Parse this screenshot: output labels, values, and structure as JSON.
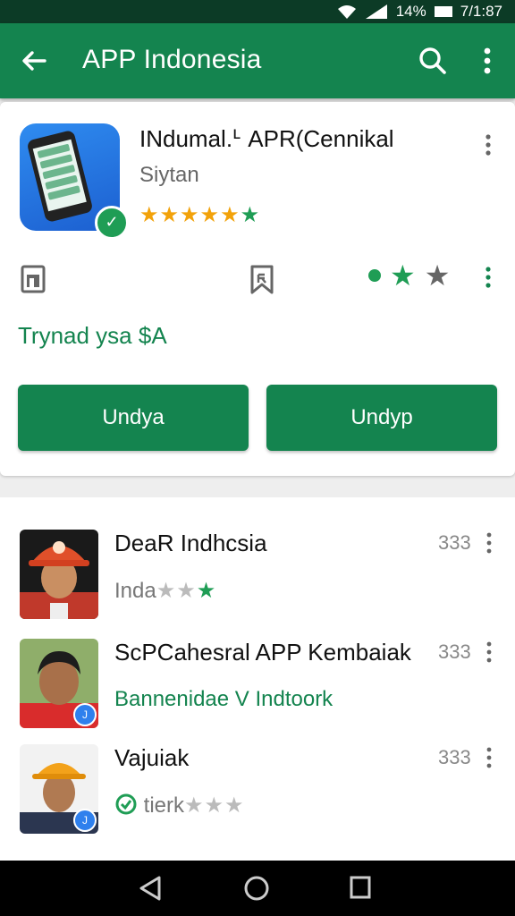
{
  "status_bar": {
    "battery": "14%",
    "time": "7/1:87"
  },
  "app_bar": {
    "title": "APP Indonesia",
    "icons": [
      "back-arrow-icon",
      "search-icon",
      "more-vert-icon"
    ]
  },
  "app": {
    "name": "INdumal.ᒻ APR(Cennikal",
    "developer": "Siytan",
    "rating_text": "★★★★★",
    "rating_last": "★",
    "price": "Trynad ysa $A",
    "button_left": "Undya",
    "button_right": "Undyp"
  },
  "list": [
    {
      "title": "DeaR Indhcsia",
      "sub": "Inda",
      "stars_grey": "★★",
      "stars_green": "★",
      "price": "333"
    },
    {
      "title": "ScPCahesral APP Kembaiak",
      "sub": "Bannenidae V Indtoork",
      "price": "333"
    },
    {
      "title": "Vajuiak",
      "sub": "tierk",
      "stars_grey": "★★★",
      "price": "333"
    }
  ],
  "colors": {
    "primary": "#14844f",
    "status": "#0c3b26",
    "star": "#f2a20a"
  }
}
